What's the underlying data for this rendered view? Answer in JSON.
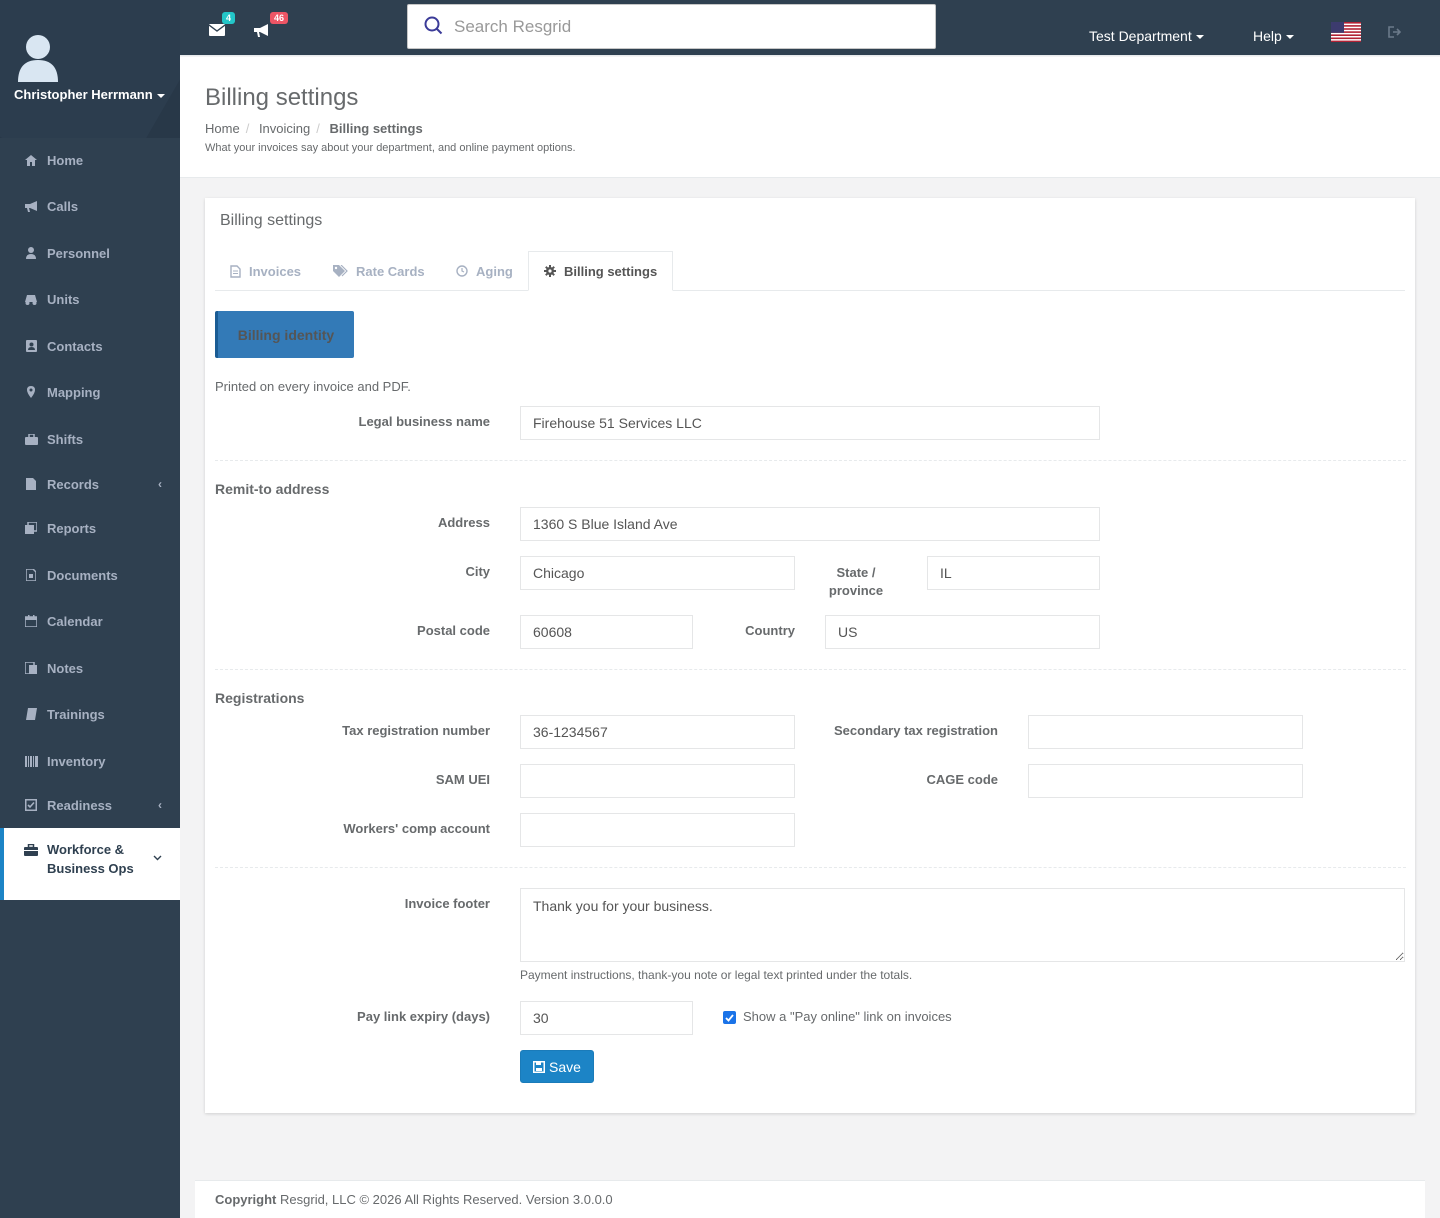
{
  "user": {
    "name": "Christopher Herrmann"
  },
  "sidebar": {
    "items": [
      {
        "label": "Home",
        "icon": "home-icon"
      },
      {
        "label": "Calls",
        "icon": "bullhorn-icon"
      },
      {
        "label": "Personnel",
        "icon": "user-icon"
      },
      {
        "label": "Units",
        "icon": "truck-icon"
      },
      {
        "label": "Contacts",
        "icon": "address-book-icon"
      },
      {
        "label": "Mapping",
        "icon": "map-marker-icon"
      },
      {
        "label": "Shifts",
        "icon": "shifts-icon"
      },
      {
        "label": "Records",
        "icon": "file-icon"
      },
      {
        "label": "Reports",
        "icon": "reports-icon"
      },
      {
        "label": "Documents",
        "icon": "document-icon"
      },
      {
        "label": "Calendar",
        "icon": "calendar-icon"
      },
      {
        "label": "Notes",
        "icon": "notes-icon"
      },
      {
        "label": "Trainings",
        "icon": "book-icon"
      },
      {
        "label": "Inventory",
        "icon": "barcode-icon"
      },
      {
        "label": "Readiness",
        "icon": "check-square-icon"
      }
    ],
    "active_item": {
      "label_line1": "Workforce &",
      "label_line2": "Business Ops",
      "icon": "briefcase-icon"
    }
  },
  "topbar": {
    "messages_count": "4",
    "calls_count": "46",
    "search_placeholder": "Search Resgrid",
    "department": "Test Department",
    "help": "Help"
  },
  "heading": {
    "title": "Billing settings",
    "breadcrumb": [
      "Home",
      "Invoicing",
      "Billing settings"
    ],
    "subtitle": "What your invoices say about your department, and online payment options."
  },
  "panel": {
    "title": "Billing settings",
    "tabs": [
      "Invoices",
      "Rate Cards",
      "Aging",
      "Billing settings"
    ],
    "identity_button": "Billing identity",
    "identity_hint": "Printed on every invoice and PDF."
  },
  "form": {
    "legal_name_label": "Legal business name",
    "legal_name_value": "Firehouse 51 Services LLC",
    "remit_heading": "Remit-to address",
    "address_label": "Address",
    "address_value": "1360 S Blue Island Ave",
    "city_label": "City",
    "city_value": "Chicago",
    "state_label_1": "State /",
    "state_label_2": "province",
    "state_value": "IL",
    "postal_label": "Postal code",
    "postal_value": "60608",
    "country_label": "Country",
    "country_value": "US",
    "registrations_heading": "Registrations",
    "tax_label": "Tax registration number",
    "tax_value": "36-1234567",
    "secondary_tax_label": "Secondary tax registration",
    "secondary_tax_value": "",
    "sam_label": "SAM UEI",
    "sam_value": "",
    "cage_label": "CAGE code",
    "cage_value": "",
    "workers_label": "Workers' comp account",
    "workers_value": "",
    "footer_label": "Invoice footer",
    "footer_value": "Thank you for your business.",
    "footer_hint": "Payment instructions, thank-you note or legal text printed under the totals.",
    "expiry_label": "Pay link expiry (days)",
    "expiry_value": "30",
    "pay_online_label": "Show a \"Pay online\" link on invoices",
    "pay_online_checked": true,
    "save_label": "Save"
  },
  "footer": {
    "copyright_bold": "Copyright",
    "copyright_text": "Resgrid, LLC © 2026 All Rights Reserved.",
    "version": "Version 3.0.0.0"
  },
  "colors": {
    "sidebar_bg": "#2f4050",
    "accent": "#1c84c6",
    "identity_button": "#337ab7",
    "messages_badge": "#23c6c8",
    "calls_badge": "#ed5565"
  }
}
